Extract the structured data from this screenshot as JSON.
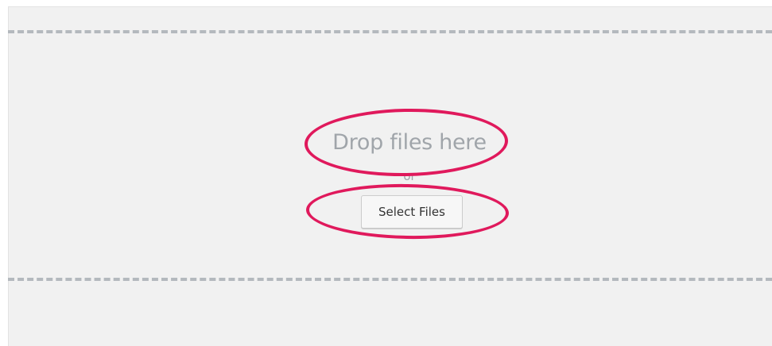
{
  "uploader": {
    "drop_instructions": "Drop files here",
    "or_label": "or",
    "select_files_label": "Select Files"
  },
  "colors": {
    "panel_background": "#f1f1f1",
    "dash_border": "#b4b9be",
    "instruction_text": "#a0a5aa",
    "annotation": "#e0195c"
  }
}
